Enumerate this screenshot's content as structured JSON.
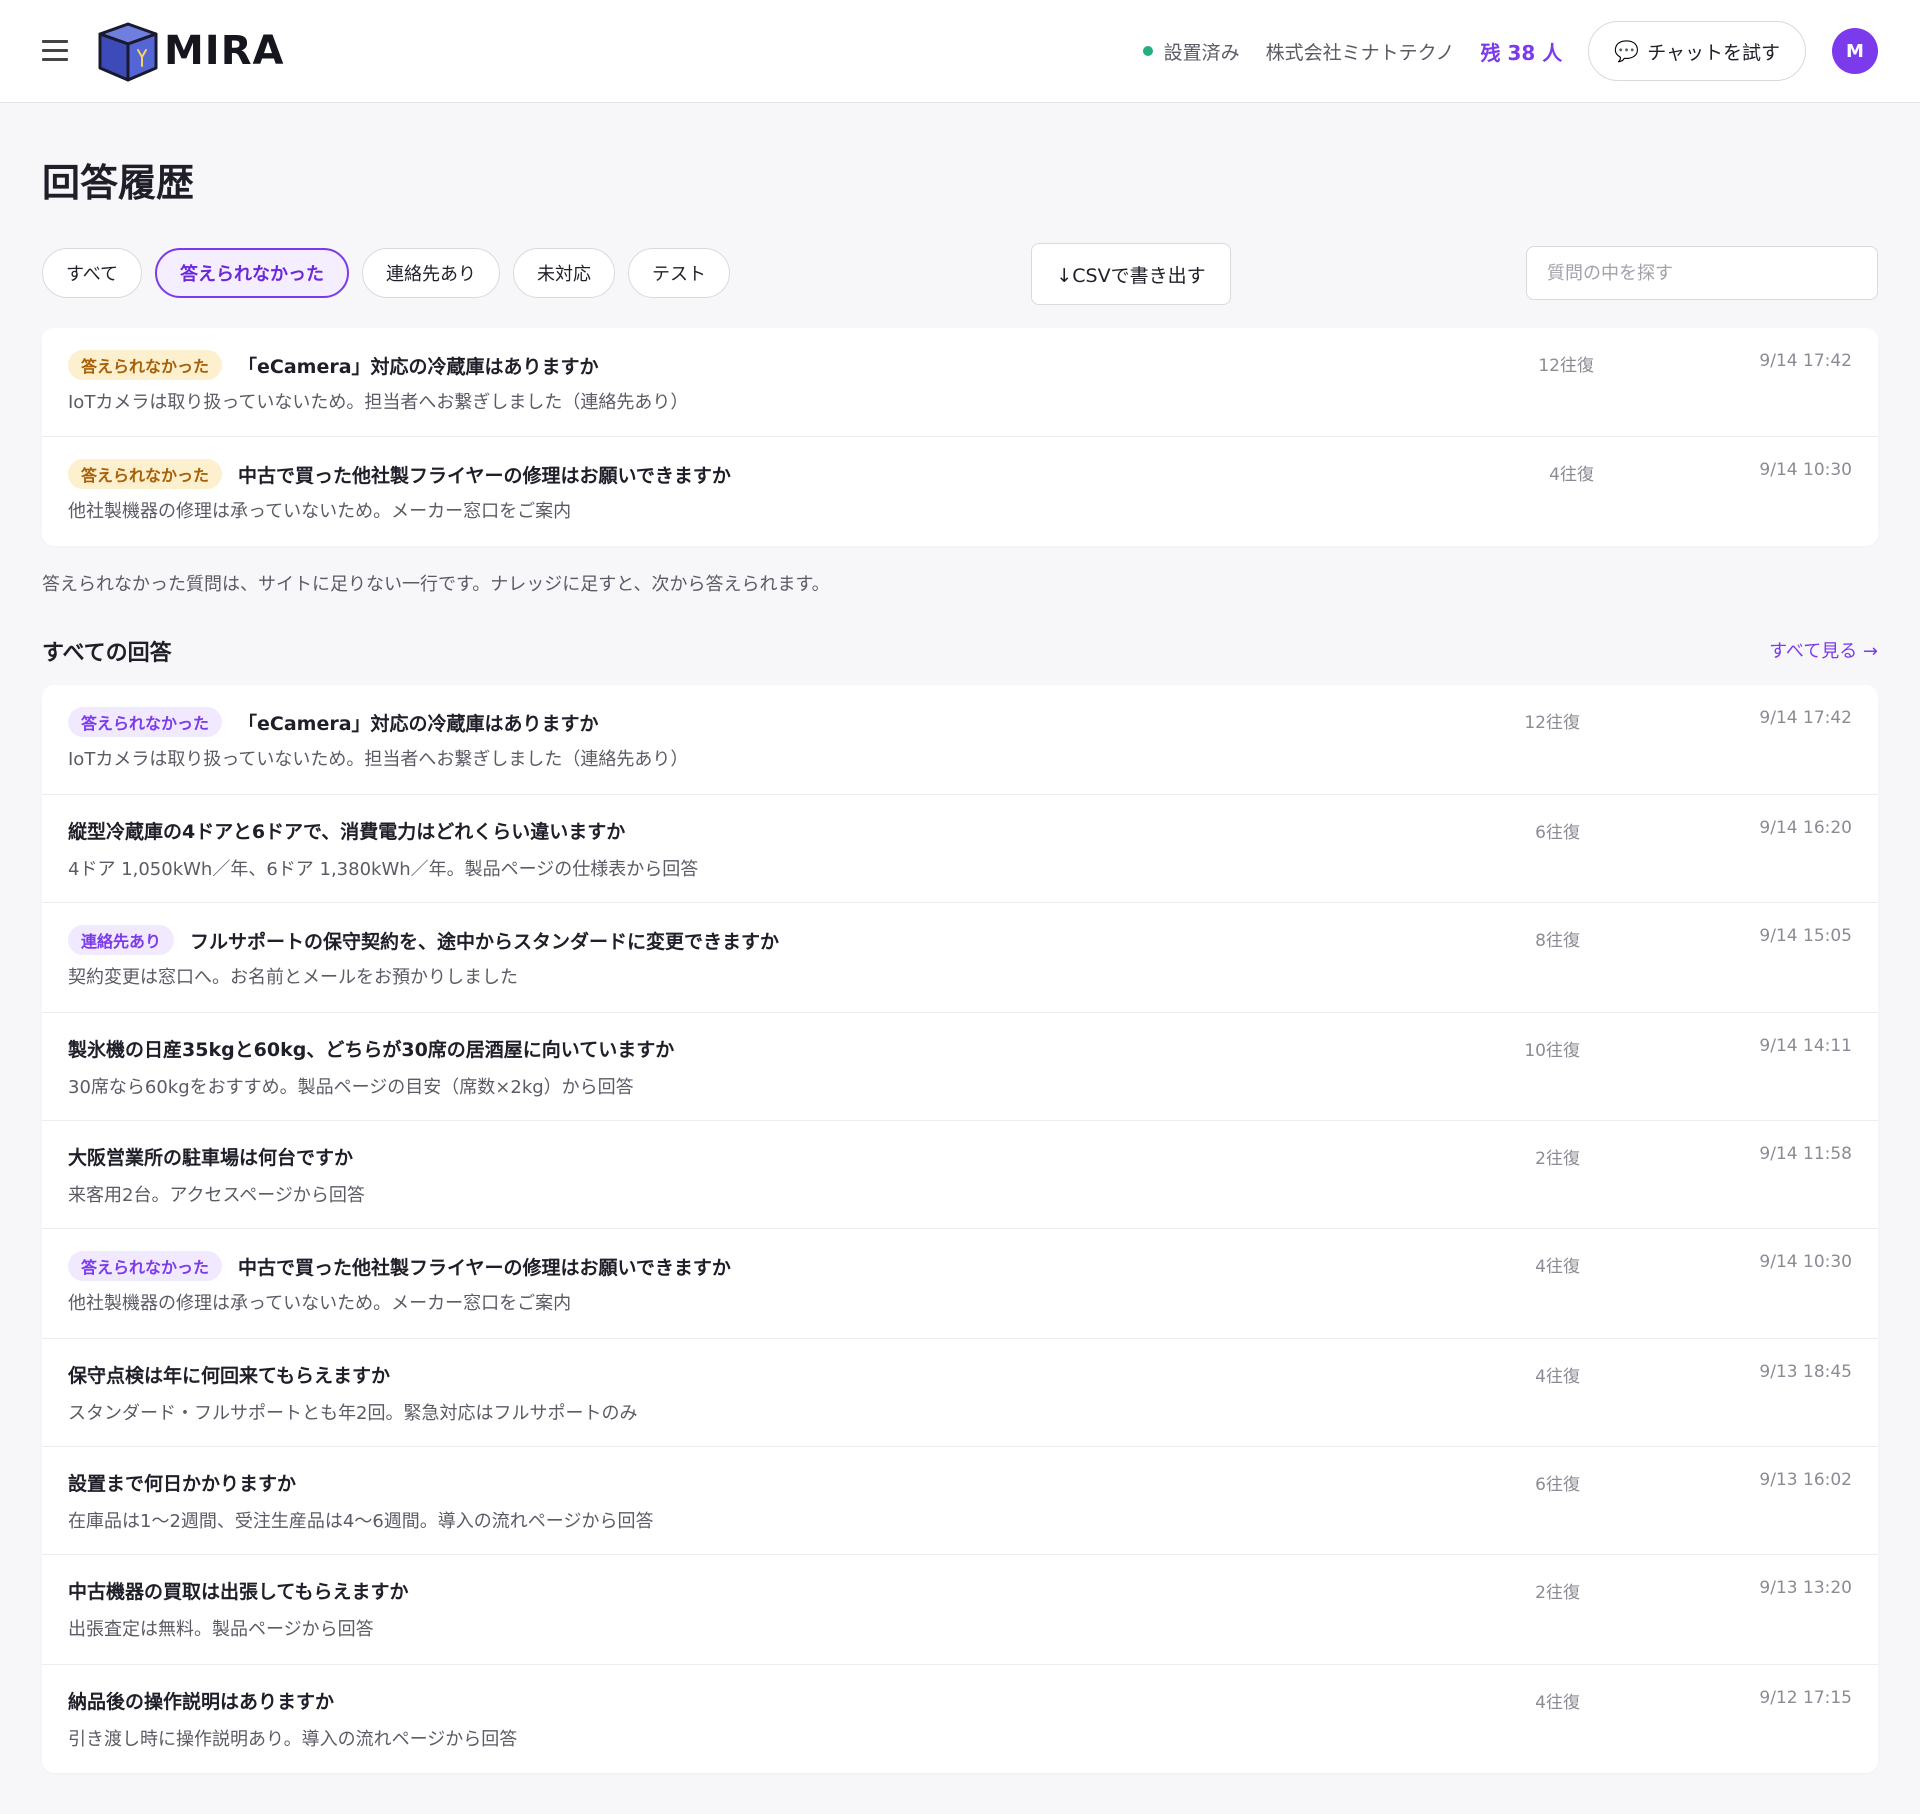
{
  "header": {
    "logo_text": "MIRA",
    "status": "設置済み",
    "company": "株式会社ミナトテクノ",
    "remaining": "残 38 人",
    "chat_button": "チャットを試す",
    "avatar_initial": "M"
  },
  "page_title": "回答履歴",
  "filters": [
    "すべて",
    "答えられなかった",
    "連絡先あり",
    "未対応",
    "テスト"
  ],
  "active_filter": "答えられなかった",
  "csv_button": "↓CSVで書き出す",
  "search_placeholder": "質問の中を探す",
  "unanswered": [
    {
      "badge": "答えられなかった",
      "question": "「eCamera」対応の冷蔵庫はありますか",
      "answer": "IoTカメラは取り扱っていないため。担当者へお繋ぎしました（連絡先あり）",
      "turns": "12往復",
      "time": "9/14 17:42"
    },
    {
      "badge": "答えられなかった",
      "question": "中古で買った他社製フライヤーの修理はお願いできますか",
      "answer": "他社製機器の修理は承っていないため。メーカー窓口をご案内",
      "turns": "4往復",
      "time": "9/14 10:30"
    }
  ],
  "note": "答えられなかった質問は、サイトに足りない一行です。ナレッジに足すと、次から答えられます。",
  "all_section": {
    "title": "すべての回答",
    "see_all": "すべて見る →"
  },
  "all_answers": [
    {
      "badge": "答えられなかった",
      "question": "「eCamera」対応の冷蔵庫はありますか",
      "answer": "IoTカメラは取り扱っていないため。担当者へお繋ぎしました（連絡先あり）",
      "turns": "12往復",
      "time": "9/14 17:42"
    },
    {
      "badge": "",
      "question": "縦型冷蔵庫の4ドアと6ドアで、消費電力はどれくらい違いますか",
      "answer": "4ドア 1,050kWh／年、6ドア 1,380kWh／年。製品ページの仕様表から回答",
      "turns": "6往復",
      "time": "9/14 16:20"
    },
    {
      "badge": "連絡先あり",
      "question": "フルサポートの保守契約を、途中からスタンダードに変更できますか",
      "answer": "契約変更は窓口へ。お名前とメールをお預かりしました",
      "turns": "8往復",
      "time": "9/14 15:05"
    },
    {
      "badge": "",
      "question": "製氷機の日産35kgと60kg、どちらが30席の居酒屋に向いていますか",
      "answer": "30席なら60kgをおすすめ。製品ページの目安（席数×2kg）から回答",
      "turns": "10往復",
      "time": "9/14 14:11"
    },
    {
      "badge": "",
      "question": "大阪営業所の駐車場は何台ですか",
      "answer": "来客用2台。アクセスページから回答",
      "turns": "2往復",
      "time": "9/14 11:58"
    },
    {
      "badge": "答えられなかった",
      "question": "中古で買った他社製フライヤーの修理はお願いできますか",
      "answer": "他社製機器の修理は承っていないため。メーカー窓口をご案内",
      "turns": "4往復",
      "time": "9/14 10:30"
    },
    {
      "badge": "",
      "question": "保守点検は年に何回来てもらえますか",
      "answer": "スタンダード・フルサポートとも年2回。緊急対応はフルサポートのみ",
      "turns": "4往復",
      "time": "9/13 18:45"
    },
    {
      "badge": "",
      "question": "設置まで何日かかりますか",
      "answer": "在庫品は1〜2週間、受注生産品は4〜6週間。導入の流れページから回答",
      "turns": "6往復",
      "time": "9/13 16:02"
    },
    {
      "badge": "",
      "question": "中古機器の買取は出張してもらえますか",
      "answer": "出張査定は無料。製品ページから回答",
      "turns": "2往復",
      "time": "9/13 13:20"
    },
    {
      "badge": "",
      "question": "納品後の操作説明はありますか",
      "answer": "引き渡し時に操作説明あり。導入の流れページから回答",
      "turns": "4往復",
      "time": "9/12 17:15"
    }
  ],
  "colors": {
    "accent": "#7c3aed",
    "status_dot": "#22b07d",
    "badge_amber_bg": "#fdf0cf",
    "badge_amber_text": "#a85f05",
    "badge_purple_bg": "#f1e9fe"
  }
}
